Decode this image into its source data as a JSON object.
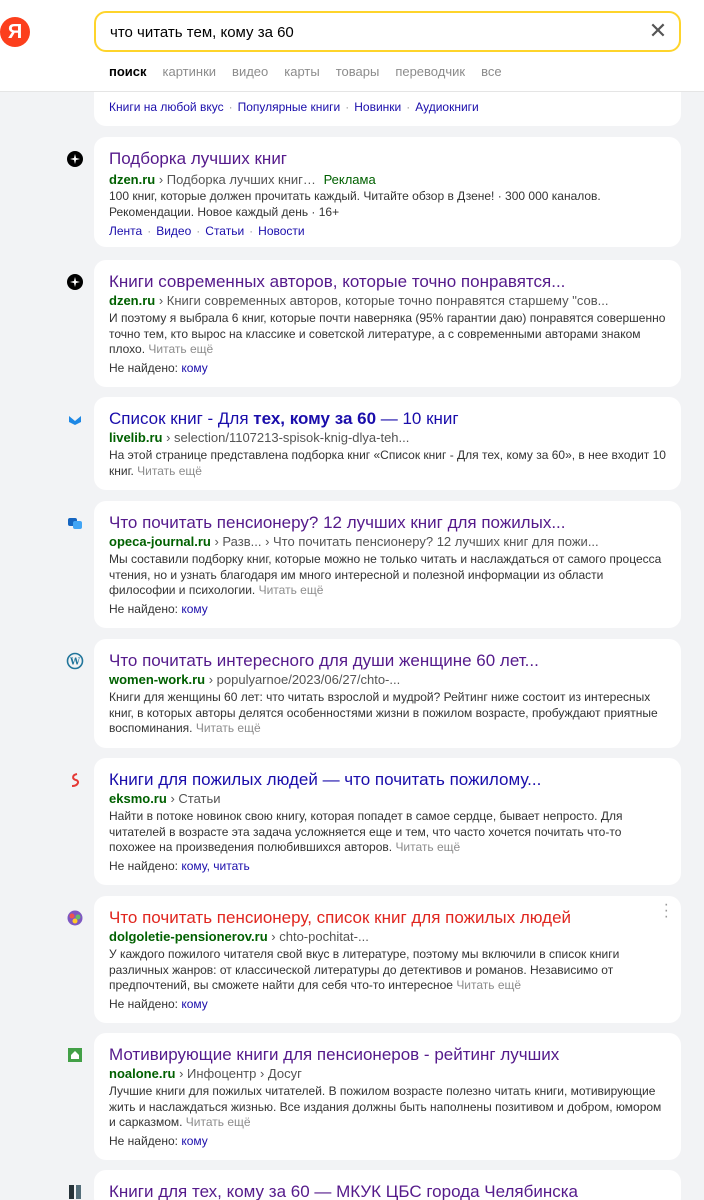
{
  "header": {
    "logo": "Я",
    "search_value": "что читать тем, кому за 60",
    "tabs": [
      "поиск",
      "картинки",
      "видео",
      "карты",
      "товары",
      "переводчик",
      "все"
    ]
  },
  "top_card": {
    "links": [
      "Книги на любой вкус",
      "Популярные книги",
      "Новинки",
      "Аудиокниги"
    ]
  },
  "results": [
    {
      "title": "Подборка лучших книг",
      "domain": "dzen.ru",
      "path": "› Подборка лучших книг…",
      "ad": "Реклама",
      "snippet": "100 книг, которые должен прочитать каждый. Читайте обзор в Дзене! · 300 000 каналов. Рекомендации. Новое каждый день · 16+",
      "sitelinks": [
        "Лента",
        "Видео",
        "Статьи",
        "Новости"
      ]
    },
    {
      "title": "Книги современных авторов, которые точно понравятся...",
      "domain": "dzen.ru",
      "path": "› Книги современных авторов, которые точно понравятся старшему \"сов...",
      "snippet": "И поэтому я выбрала 6 книг, которые почти наверняка (95% гарантии даю) понравятся совершенно точно тем, кто вырос на классике и советской литературе, а с современными авторами знаком плохо.",
      "more": "Читать ещё",
      "notfound_label": "Не найдено:",
      "notfound_words": "кому"
    },
    {
      "title_a": "Список книг - Для ",
      "title_b": "тех, кому за 60",
      "title_c": " — 10 книг",
      "domain": "livelib.ru",
      "path": "› selection/1107213-spisok-knig-dlya-teh...",
      "snippet": "На этой странице представлена подборка книг «Список книг - Для тех, кому за 60», в нее входит 10 книг.",
      "more": "Читать ещё"
    },
    {
      "title": "Что почитать пенсионеру? 12 лучших книг для пожилых...",
      "domain": "opeca-journal.ru",
      "path": "› Разв...  › Что почитать пенсионеру? 12 лучших книг для пожи...",
      "snippet": "Мы составили подборку книг, которые можно не только читать и наслаждаться от самого процесса чтения, но и узнать благодаря им много интересной и полезной информации из области философии и психологии.",
      "more": "Читать ещё",
      "notfound_label": "Не найдено:",
      "notfound_words": "кому"
    },
    {
      "title": "Что почитать интересного для души женщине 60 лет...",
      "domain": "women-work.ru",
      "path": "› populyarnoe/2023/06/27/chto-...",
      "snippet": "Книги для женщины 60 лет: что читать взрослой и мудрой? Рейтинг ниже состоит из интересных книг, в которых авторы делятся особенностями жизни в пожилом возрасте, пробуждают приятные воспоминания.",
      "more": "Читать ещё"
    },
    {
      "title": "Книги для пожилых людей — что почитать пожилому...",
      "domain": "eksmo.ru",
      "path": "› Статьи",
      "snippet": "Найти в потоке новинок свою книгу, которая попадет в самое сердце, бывает непросто. Для читателей в возрасте эта задача усложняется еще и тем, что часто хочется почитать что-то похожее на произведения полюбившихся авторов.",
      "more": "Читать ещё",
      "notfound_label": "Не найдено:",
      "notfound_words": "кому, читать"
    },
    {
      "title": "Что почитать пенсионеру, список книг для пожилых людей",
      "domain": "dolgoletie-pensionerov.ru",
      "path": "› chto-pochitat-...",
      "snippet": "У каждого пожилого читателя свой вкус в литературе, поэтому мы включили в список книги различных жанров: от классической литературы до детективов и романов. Независимо от предпочтений, вы сможете найти для себя что-то интересное",
      "more": "Читать ещё",
      "notfound_label": "Не найдено:",
      "notfound_words": "кому"
    },
    {
      "title": "Мотивирующие книги для пенсионеров - рейтинг лучших",
      "domain": "noalone.ru",
      "path": "› Инфоцентр › Досуг",
      "snippet": "Лучшие книги для пожилых читателей. В пожилом возрасте полезно читать книги, мотивирующие жить и наслаждаться жизнью. Все издания должны быть наполнены позитивом и добром, юмором и сарказмом.",
      "more": "Читать ещё",
      "notfound_label": "Не найдено:",
      "notfound_words": "кому"
    },
    {
      "title": "Книги для тех, кому за 60 — МКУК ЦБС города Челябинска"
    }
  ],
  "colors": {
    "accent_yellow": "#fed42b",
    "logo_red": "#fc3f1d",
    "visited": "#551a8b",
    "link": "#1a0dab",
    "url_green": "#006000",
    "ad_red": "#e0261f"
  }
}
